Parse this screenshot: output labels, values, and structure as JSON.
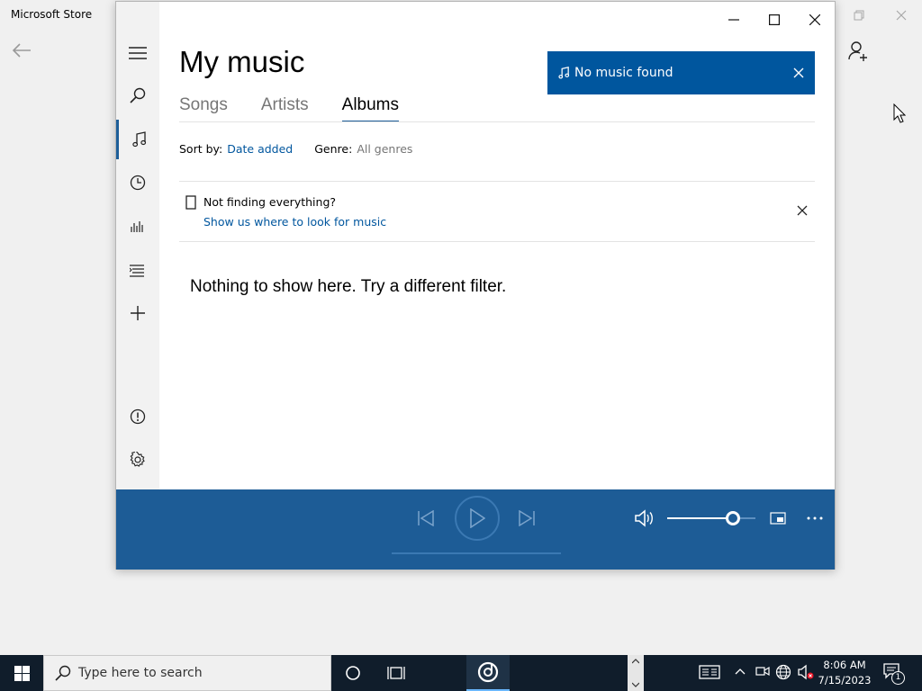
{
  "store": {
    "title": "Microsoft Store",
    "icons": {
      "back": "back-arrow-icon",
      "restore": "restore-icon",
      "close": "close-icon",
      "user": "add-user-icon"
    }
  },
  "music_app": {
    "page_title": "My music",
    "tabs": [
      {
        "label": "Songs",
        "selected": false
      },
      {
        "label": "Artists",
        "selected": false
      },
      {
        "label": "Albums",
        "selected": true
      }
    ],
    "notice": {
      "text": "No music found",
      "icon": "music-note-icon"
    },
    "sort": {
      "label": "Sort by:",
      "value": "Date added"
    },
    "genre": {
      "label": "Genre:",
      "value": "All genres"
    },
    "hint": {
      "title": "Not finding everything?",
      "link": "Show us where to look for music"
    },
    "empty_message": "Nothing to show here. Try a different filter.",
    "nav_icons": [
      "hamburger-menu-icon",
      "search-icon",
      "music-note-icon",
      "recent-clock-icon",
      "now-playing-icon",
      "playlist-icon",
      "add-icon",
      "feedback-icon",
      "settings-gear-icon"
    ],
    "accent_color": "#1d5c96",
    "player": {
      "volume_percent": 0.74,
      "icons": [
        "previous-icon",
        "play-icon",
        "next-icon",
        "volume-icon",
        "mini-view-icon",
        "more-icon"
      ]
    }
  },
  "taskbar": {
    "search_placeholder": "Type here to search",
    "time": "8:06 AM",
    "date": "7/15/2023",
    "notification_count": "1"
  }
}
